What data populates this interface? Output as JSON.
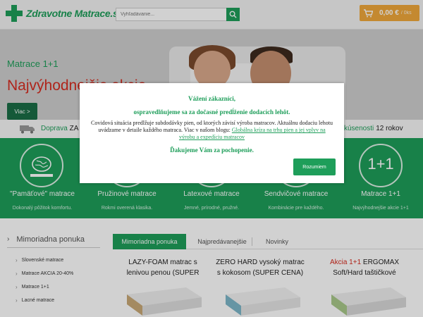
{
  "header": {
    "logo_text": "Zdravotne Matrace.sk",
    "search_placeholder": "Vyhľadávanie...",
    "cart_price": "0,00 €",
    "cart_items": "/ 0ks"
  },
  "hero": {
    "subtitle": "Matrace 1+1",
    "title": "Najvýhodnejšie akcie",
    "button": "Viac >"
  },
  "info_bar": {
    "doprava_label": "Doprava",
    "doprava_value": "ZA",
    "experience_label": "kúsenosti",
    "experience_value": "12 rokov"
  },
  "categories": [
    {
      "name": "\"Pamäťové\" matrace",
      "desc": "Dokonalý pôžitok komfortu.",
      "icon": "brain-icon"
    },
    {
      "name": "Pružinové matrace",
      "desc": "Rokmi overená klasika.",
      "icon": "spring-icon"
    },
    {
      "name": "Latexové matrace",
      "desc": "Jemné, prírodné, pružné.",
      "icon": "latex-icon"
    },
    {
      "name": "Sendvičové matrace",
      "desc": "Kombinácie pre každého.",
      "icon": "sandwich-icon"
    },
    {
      "name": "Matrace 1+1",
      "desc": "Najvýhodnejšie akcie 1+1",
      "badge": "1+1"
    }
  ],
  "sidebar": {
    "title": "Mimoriadna ponuka",
    "items": [
      "Slovenské matrace",
      "Matrace AKCIA 20-40%",
      "Matrace 1+1",
      "Lacné matrace"
    ]
  },
  "tabs": [
    "Mimoriadna ponuka",
    "Najpredávanejšie",
    "Novinky"
  ],
  "products": [
    {
      "line1": "LAZY-FOAM matrac s",
      "line2": "lenivou penou (SUPER"
    },
    {
      "line1": "ZERO HARD vysoký matrac",
      "line2": "s kokosom (SUPER CENA)"
    },
    {
      "line1_red": "Akcia 1+1",
      "line1": " ERGOMAX",
      "line2": "Soft/Hard taštičkové"
    }
  ],
  "modal": {
    "title": "Vážení zákazníci,",
    "subtitle": "ospravedlňujeme sa za dočasné predĺženie dodacích lehôt.",
    "body": "Covidová situácia predlžuje subdodávky pien, od ktorých závisí výroba matracov. Aktuálnu dodaciu lehotu uvádzame v detaile každého matraca. Viac v našom blogu:",
    "link": "Globálna kríza na trhu pien a jej vplyv na výrobu a expedíciu matracov",
    "thanks": "Ďakujeme Vám za pochopenie.",
    "button": "Rozumiem"
  },
  "colors": {
    "brand_green": "#1e9e5a",
    "dark_green": "#1a6d46",
    "red": "#d62c20",
    "cart_orange": "#f0a83b"
  }
}
